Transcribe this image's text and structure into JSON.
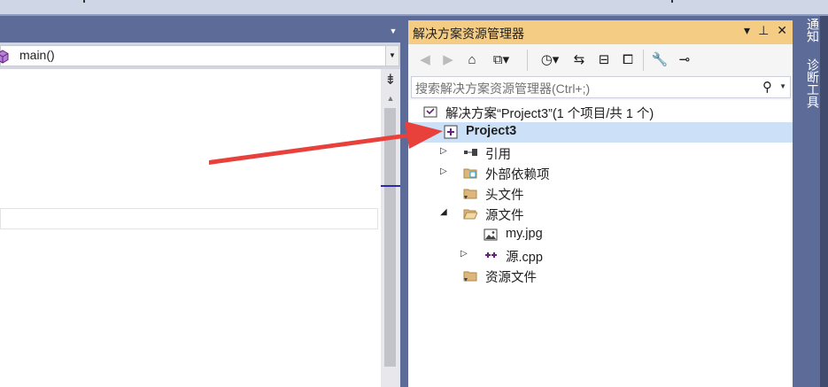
{
  "editor": {
    "member_combo": "main()"
  },
  "solution_explorer": {
    "title": "解决方案资源管理器",
    "title_buttons": [
      "▾",
      "⊥",
      "✕"
    ],
    "search_placeholder": "搜索解决方案资源管理器(Ctrl+;)",
    "tree": [
      {
        "label": "解决方案“Project3”(1 个项目/共 1 个)",
        "icon": "solution-icon",
        "level": 0,
        "expander": "",
        "bold": false,
        "selected": false
      },
      {
        "label": "Project3",
        "icon": "project-icon",
        "level": 1,
        "expander": "",
        "bold": true,
        "selected": true
      },
      {
        "label": "引用",
        "icon": "references-icon",
        "level": 2,
        "expander": "▷",
        "bold": false,
        "selected": false
      },
      {
        "label": "外部依赖项",
        "icon": "external-deps-icon",
        "level": 2,
        "expander": "▷",
        "bold": false,
        "selected": false
      },
      {
        "label": "头文件",
        "icon": "filter-folder-icon",
        "level": 2,
        "expander": "",
        "bold": false,
        "selected": false
      },
      {
        "label": "源文件",
        "icon": "filter-folder-open-icon",
        "level": 2,
        "expander": "◢",
        "bold": false,
        "selected": false
      },
      {
        "label": "my.jpg",
        "icon": "image-file-icon",
        "level": 3,
        "expander": "",
        "bold": false,
        "selected": false
      },
      {
        "label": "源.cpp",
        "icon": "cpp-file-icon",
        "level": 3,
        "expander": "▷",
        "bold": false,
        "selected": false
      },
      {
        "label": "资源文件",
        "icon": "filter-folder-icon",
        "level": 2,
        "expander": "",
        "bold": false,
        "selected": false
      }
    ]
  },
  "side_tabs": [
    "通知",
    "诊断工具"
  ],
  "colors": {
    "title_active": "#f5cc84",
    "selection": "#cce0f7",
    "chrome": "#5d6b99",
    "annotation_arrow": "#e8403a"
  }
}
